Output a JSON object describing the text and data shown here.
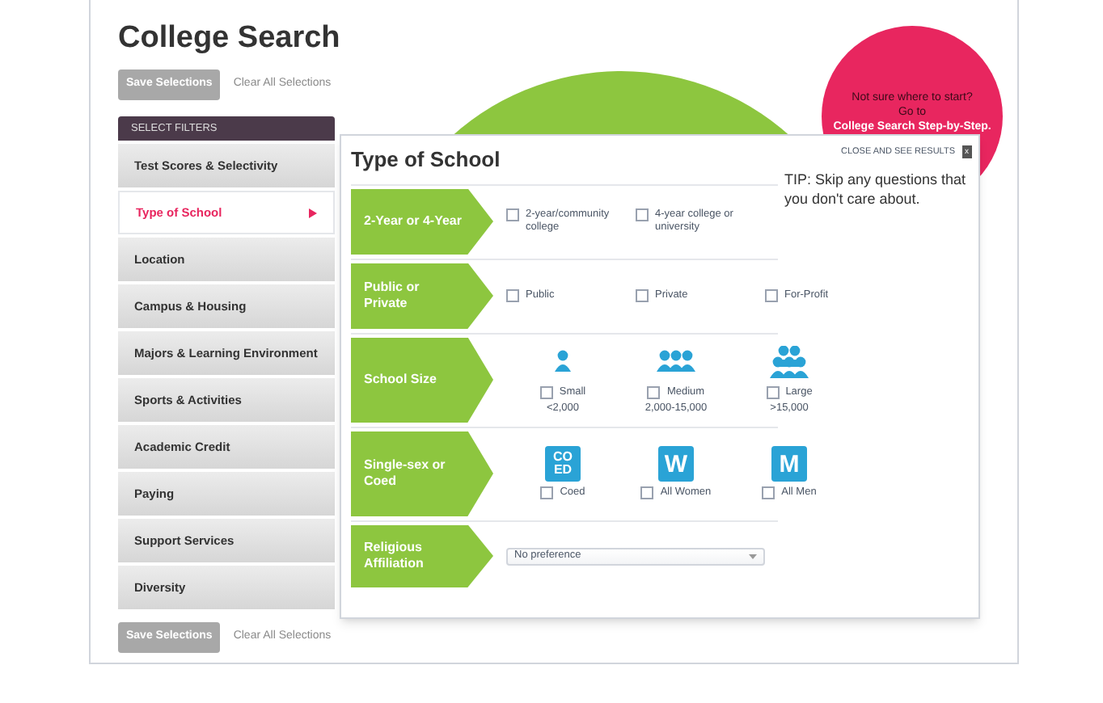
{
  "title": "College Search",
  "top_actions": {
    "save": "Save Selections",
    "clear": "Clear All Selections"
  },
  "sidebar": {
    "heading": "SELECT FILTERS",
    "items": [
      {
        "label": "Test Scores & Selectivity",
        "selected": false
      },
      {
        "label": "Type of School",
        "selected": true
      },
      {
        "label": "Location",
        "selected": false
      },
      {
        "label": "Campus & Housing",
        "selected": false
      },
      {
        "label": "Majors & Learning Environment",
        "selected": false
      },
      {
        "label": "Sports & Activities",
        "selected": false
      },
      {
        "label": "Academic Credit",
        "selected": false
      },
      {
        "label": "Paying",
        "selected": false
      },
      {
        "label": "Support Services",
        "selected": false
      },
      {
        "label": "Diversity",
        "selected": false
      }
    ]
  },
  "bottom_actions": {
    "save": "Save Selections",
    "clear": "Clear All Selections"
  },
  "promo": {
    "text": "Not sure where to start?",
    "prefix": "Go to",
    "link": "College Search Step-by-Step."
  },
  "panel": {
    "title": "Type of School",
    "close": "CLOSE AND SEE RESULTS",
    "close_icon": "x",
    "tip": "TIP: Skip any questions that you don't care about.",
    "rows": [
      {
        "label": "2-Year or 4-Year",
        "kind": "checks",
        "options": [
          {
            "label": "2-year/community college",
            "checked": false
          },
          {
            "label": "4-year college or university",
            "checked": false
          }
        ]
      },
      {
        "label": "Public or Private",
        "kind": "checks",
        "options": [
          {
            "label": "Public",
            "checked": false
          },
          {
            "label": "Private",
            "checked": false
          },
          {
            "label": "For-Profit",
            "checked": false
          }
        ]
      },
      {
        "label": "School Size",
        "kind": "sizes",
        "options": [
          {
            "label": "Small",
            "sub": "<2,000",
            "checked": false
          },
          {
            "label": "Medium",
            "sub": "2,000-15,000",
            "checked": false
          },
          {
            "label": "Large",
            "sub": ">15,000",
            "checked": false
          }
        ]
      },
      {
        "label": "Single-sex or Coed",
        "kind": "tiles",
        "options": [
          {
            "tile": [
              "CO",
              "ED"
            ],
            "label": "Coed",
            "checked": false
          },
          {
            "tile": [
              "W"
            ],
            "label": "All Women",
            "checked": false
          },
          {
            "tile": [
              "M"
            ],
            "label": "All Men",
            "checked": false
          }
        ]
      },
      {
        "label": "Religious Affiliation",
        "kind": "select",
        "value": "No preference"
      }
    ]
  }
}
